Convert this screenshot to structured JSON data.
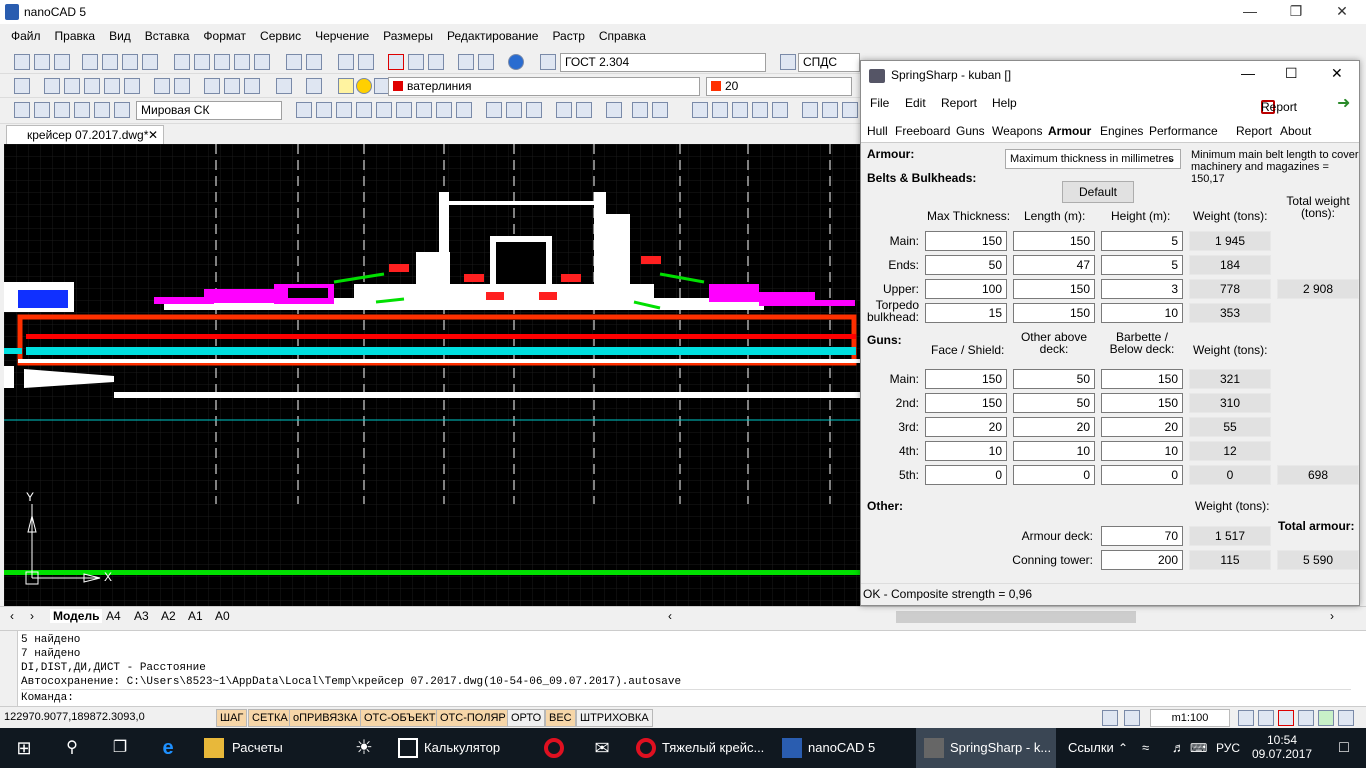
{
  "app": {
    "title": "nanoCAD 5"
  },
  "menu": [
    "Файл",
    "Правка",
    "Вид",
    "Вставка",
    "Формат",
    "Сервис",
    "Черчение",
    "Размеры",
    "Редактирование",
    "Растр",
    "Справка"
  ],
  "toolbar": {
    "text_style": "ГОСТ 2.304",
    "dim_style": "СПДС",
    "layer": "ватерлиния",
    "color_value": "20",
    "ucs": "Мировая СК"
  },
  "document_tab": {
    "label": "крейсер 07.2017.dwg*"
  },
  "layout_tabs": [
    "Модель",
    "A4",
    "A3",
    "A2",
    "A1",
    "A0"
  ],
  "command_history": [
    "5 найдено",
    "7 найдено",
    "DI,DIST,ДИ,ДИСТ - Расстояние",
    "Автосохранение: C:\\Users\\8523~1\\AppData\\Local\\Temp\\крейсер 07.2017.dwg(10-54-06_09.07.2017).autosave"
  ],
  "command_prompt": "Команда:",
  "status": {
    "coords": "122970.9077,189872.3093,0",
    "toggles": [
      {
        "label": "ШАГ",
        "on": true
      },
      {
        "label": "СЕТКА",
        "on": true
      },
      {
        "label": "оПРИВЯЗКА",
        "on": true
      },
      {
        "label": "ОТС-ОБЪЕКТ",
        "on": true
      },
      {
        "label": "ОТС-ПОЛЯР",
        "on": true
      },
      {
        "label": "ОРТО",
        "on": false
      },
      {
        "label": "ВЕС",
        "on": true
      },
      {
        "label": "ШТРИХОВКА",
        "on": false
      }
    ],
    "scale": "m1:100"
  },
  "springsharp": {
    "title": "SpringSharp - kuban []",
    "menu": [
      "File",
      "Edit",
      "Report",
      "Help"
    ],
    "report_button": "Report",
    "tabs": [
      "Hull",
      "Freeboard",
      "Guns",
      "Weapons",
      "Armour",
      "Engines",
      "Performance",
      "Report",
      "About"
    ],
    "active_tab": "Armour",
    "armour_label": "Armour:",
    "belts_label": "Belts & Bulkheads:",
    "thickness_mode": "Maximum thickness in millimetres",
    "min_belt_note": "Minimum main belt length to cover machinery and magazines = 150,17",
    "default_button": "Default",
    "belt_headers": [
      "Max Thickness:",
      "Length (m):",
      "Height (m):",
      "Weight (tons):"
    ],
    "total_weight_header": "Total weight (tons):",
    "belts": [
      {
        "name": "Main:",
        "thickness": "150",
        "length": "150",
        "height": "5",
        "weight": "1 945"
      },
      {
        "name": "Ends:",
        "thickness": "50",
        "length": "47",
        "height": "5",
        "weight": "184"
      },
      {
        "name": "Upper:",
        "thickness": "100",
        "length": "150",
        "height": "3",
        "weight": "778"
      },
      {
        "name": "Torpedo bulkhead:",
        "thickness": "15",
        "length": "150",
        "height": "10",
        "weight": "353"
      }
    ],
    "belts_total": "2 908",
    "guns_label": "Guns:",
    "gun_headers": [
      "Face / Shield:",
      "Other above deck:",
      "Barbette / Below deck:",
      "Weight (tons):"
    ],
    "guns": [
      {
        "name": "Main:",
        "face": "150",
        "other": "50",
        "barbette": "150",
        "weight": "321"
      },
      {
        "name": "2nd:",
        "face": "150",
        "other": "50",
        "barbette": "150",
        "weight": "310"
      },
      {
        "name": "3rd:",
        "face": "20",
        "other": "20",
        "barbette": "20",
        "weight": "55"
      },
      {
        "name": "4th:",
        "face": "10",
        "other": "10",
        "barbette": "10",
        "weight": "12"
      },
      {
        "name": "5th:",
        "face": "0",
        "other": "0",
        "barbette": "0",
        "weight": "0"
      }
    ],
    "guns_total": "698",
    "other_label": "Other:",
    "other_weight_header": "Weight (tons):",
    "total_armour_label": "Total armour:",
    "armour_deck": {
      "label": "Armour deck:",
      "value": "70",
      "weight": "1 517"
    },
    "conning_tower": {
      "label": "Conning tower:",
      "value": "200",
      "weight": "115"
    },
    "total_armour": "5 590",
    "status_line": "OK - Composite strength = 0,96"
  },
  "taskbar": {
    "items": [
      "Расчеты",
      "Калькулятор",
      "Тяжелый крейс...",
      "nanoCAD 5",
      "SpringSharp - k..."
    ],
    "links": "Ссылки",
    "lang": "РУС",
    "time": "10:54",
    "date": "09.07.2017"
  },
  "colors": {
    "accent_red": "#ff0000",
    "magenta": "#ff00ff",
    "green": "#00ff00",
    "cyan": "#00ffff",
    "taskbar": "#101820"
  }
}
